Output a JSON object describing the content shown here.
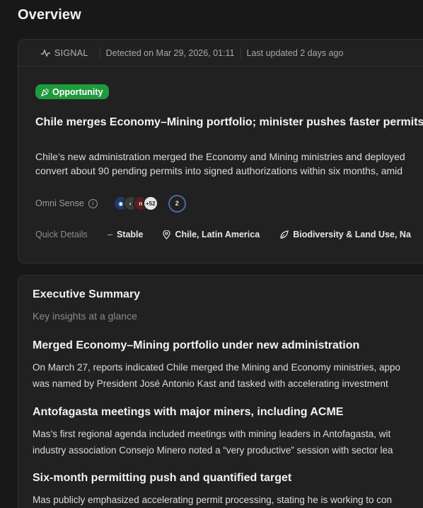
{
  "page": {
    "title": "Overview"
  },
  "signal": {
    "type_label": "SIGNAL",
    "detected": "Detected on Mar 29, 2026, 01:11",
    "updated": "Last updated 2 days ago",
    "badge": "Opportunity",
    "title": "Chile merges Economy–Mining portfolio; minister pushes faster permits",
    "description_lines": [
      "Chile’s new administration merged the Economy and Mining ministries and deployed",
      "convert about 90 pending permits into signed authorizations within six months, amid"
    ],
    "omni_label": "Omni Sense",
    "avatar_more": "+52",
    "source_count": "2",
    "quick_label": "Quick Details",
    "trend": "Stable",
    "location": "Chile, Latin America",
    "topics": "Biodiversity & Land Use, Na"
  },
  "summary": {
    "title": "Executive Summary",
    "subtitle": "Key insights at a glance",
    "insights": [
      {
        "heading": "Merged Economy–Mining portfolio under new administration",
        "lines": [
          "On March 27, reports indicated Chile merged the Mining and Economy ministries, appo",
          "was named by President José Antonio Kast and tasked with accelerating investment"
        ]
      },
      {
        "heading": "Antofagasta meetings with major miners, including ACME",
        "lines": [
          "Mas’s first regional agenda included meetings with mining leaders in Antofagasta, wit",
          "industry association Consejo Minero noted a “very productive” session with sector lea"
        ]
      },
      {
        "heading": "Six-month permitting push and quantified target",
        "lines": [
          "Mas publicly emphasized accelerating permit processing, stating he is working to con"
        ]
      }
    ]
  },
  "colors": {
    "badge": "#1f9a3c",
    "background": "#181818",
    "card": "#212121"
  }
}
